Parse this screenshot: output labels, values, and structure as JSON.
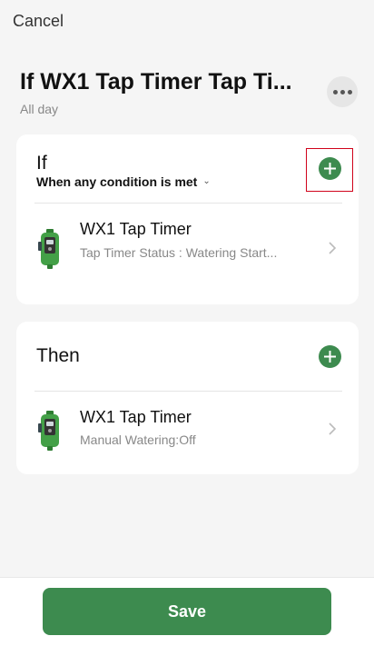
{
  "header": {
    "cancel_label": "Cancel",
    "title": "If WX1 Tap Timer Tap Ti...",
    "subtitle": "All day",
    "more_icon": "more-horizontal-icon"
  },
  "if_section": {
    "title": "If",
    "condition_selected": "When any condition is met",
    "add_icon": "plus-circle-icon",
    "items": [
      {
        "title": "WX1 Tap Timer",
        "subtitle": "Tap Timer Status : Watering Start...",
        "icon": "tap-timer-device-icon"
      }
    ]
  },
  "then_section": {
    "title": "Then",
    "add_icon": "plus-circle-icon",
    "items": [
      {
        "title": "WX1 Tap Timer",
        "subtitle": "Manual Watering:Off",
        "icon": "tap-timer-device-icon"
      }
    ]
  },
  "footer": {
    "save_label": "Save"
  },
  "colors": {
    "accent": "#3d8b4f",
    "highlight": "#d0021b",
    "background": "#f5f5f5",
    "card": "#ffffff"
  }
}
